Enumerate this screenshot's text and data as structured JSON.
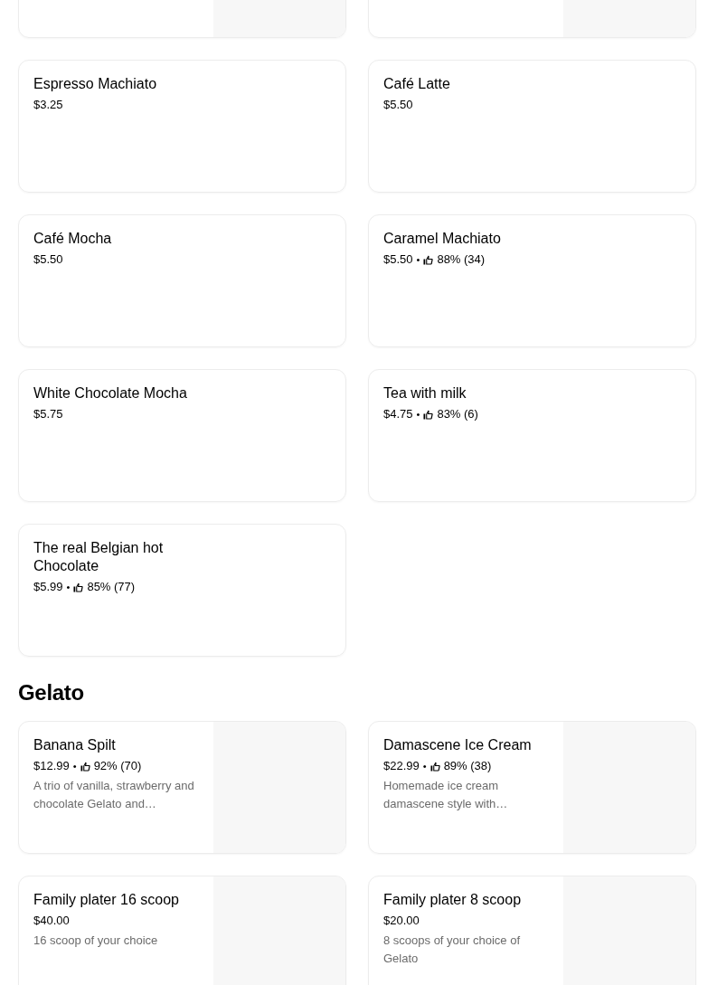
{
  "sections": [
    {
      "cards": [
        {
          "image": {
            "kind": "picture"
          }
        },
        {
          "image": {
            "kind": "picture"
          }
        },
        {
          "name": "Espresso Machiato",
          "price": "$3.25"
        },
        {
          "name": "Café Latte",
          "price": "$5.50"
        },
        {
          "name": "Café Mocha",
          "price": "$5.50"
        },
        {
          "name": "Caramel Machiato",
          "price": "$5.50",
          "rating": {
            "separator": "•",
            "text": "88% (34)"
          }
        },
        {
          "name": "White Chocolate Mocha",
          "price": "$5.75"
        },
        {
          "name": "Tea with milk",
          "price": "$4.75",
          "rating": {
            "separator": "•",
            "text": "83% (6)"
          }
        },
        {
          "name": "The real Belgian hot Chocolate",
          "price": "$5.99",
          "rating": {
            "separator": "•",
            "text": "85% (77)"
          }
        }
      ]
    },
    {
      "title": "Gelato",
      "cards": [
        {
          "name": "Banana Spilt",
          "price": "$12.99",
          "rating": {
            "separator": "•",
            "text": "92% (70)"
          },
          "description": "A trio of vanilla, strawberry and chocolate Gelato and…",
          "image": {
            "kind": "picture"
          }
        },
        {
          "name": "Damascene Ice Cream",
          "price": "$22.99",
          "rating": {
            "separator": "•",
            "text": "89% (38)"
          },
          "description": "Homemade ice cream damascene style with…",
          "image": {
            "kind": "picture"
          }
        },
        {
          "name": "Family plater 16 scoop",
          "price": "$40.00",
          "description": "16 scoop of your choice",
          "image": {
            "kind": "picture"
          }
        },
        {
          "name": "Family plater 8 scoop",
          "price": "$20.00",
          "description": "8 scoops of your choice of Gelato",
          "image": {
            "kind": "picture"
          }
        }
      ]
    }
  ]
}
